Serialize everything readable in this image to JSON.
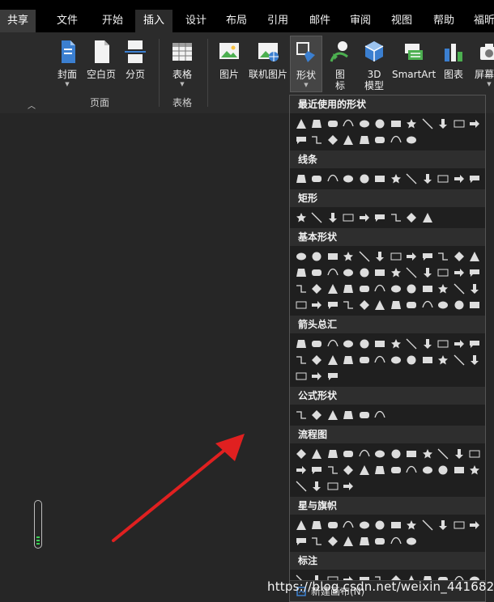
{
  "tabs": [
    {
      "id": "share",
      "label": "共享"
    },
    {
      "id": "file",
      "label": "文件"
    },
    {
      "id": "home",
      "label": "开始"
    },
    {
      "id": "insert",
      "label": "插入",
      "active": true
    },
    {
      "id": "design",
      "label": "设计"
    },
    {
      "id": "layout",
      "label": "布局"
    },
    {
      "id": "references",
      "label": "引用"
    },
    {
      "id": "mailings",
      "label": "邮件"
    },
    {
      "id": "review",
      "label": "审阅"
    },
    {
      "id": "view",
      "label": "视图"
    },
    {
      "id": "help",
      "label": "帮助"
    },
    {
      "id": "foxit",
      "label": "福昕"
    }
  ],
  "ribbon": {
    "cover": "封面",
    "blank_page": "空白页",
    "page_break": "分页",
    "group_pages": "页面",
    "table": "表格",
    "group_table": "表格",
    "picture": "图片",
    "online_picture": "联机图片",
    "shapes": "形状",
    "icons_line1": "图",
    "icons_line2": "标",
    "model_line1": "3D",
    "model_line2": "模型",
    "smartart": "SmartArt",
    "chart": "图表",
    "screenshot": "屏幕截"
  },
  "shapes_menu": {
    "recent": "最近使用的形状",
    "lines": "线条",
    "rectangles": "矩形",
    "basic": "基本形状",
    "block_arrows": "箭头总汇",
    "equation": "公式形状",
    "flowchart": "流程图",
    "stars": "星与旗帜",
    "callouts": "标注",
    "new_canvas": "新建画布(N)"
  },
  "watermark": "https://blog.csdn.net/weixin_44168217",
  "colors": {
    "background": "#262626",
    "ribbon": "#2b2b2b",
    "tabbar": "#000000",
    "accent_red": "#e02020",
    "scroll_green": "#39d353"
  }
}
